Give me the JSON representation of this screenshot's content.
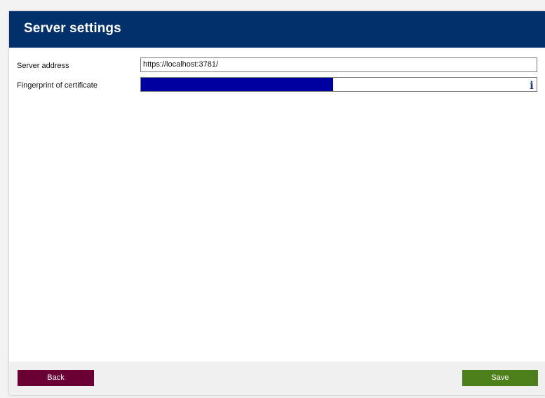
{
  "header": {
    "title": "Server settings"
  },
  "form": {
    "server_address": {
      "label": "Server address",
      "value": "https://localhost:3781/"
    },
    "fingerprint": {
      "label": "Fingerprint of certificate",
      "fill_fraction": 0.486
    },
    "info_icon": {
      "name": "info-icon",
      "glyph": "i",
      "color": "#1a3a7a"
    }
  },
  "footer": {
    "back_label": "Back",
    "save_label": "Save"
  },
  "colors": {
    "header_bg": "#02306a",
    "back_button": "#6b0035",
    "save_button": "#4d7f1a",
    "fingerprint_fill": "#0000a0"
  }
}
